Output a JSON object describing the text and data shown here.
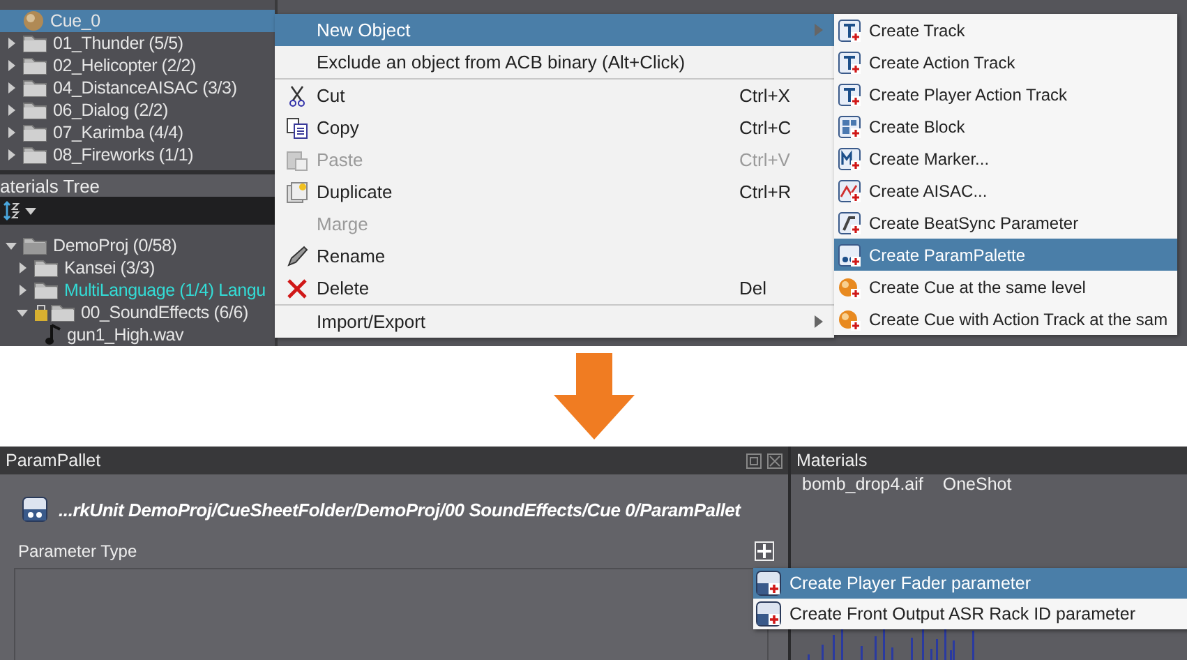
{
  "cue_tree": {
    "items": [
      {
        "label": "Cue_0",
        "kind": "cue",
        "selected": true
      },
      {
        "label": "01_Thunder (5/5)",
        "kind": "folder",
        "expanded": false,
        "selected": false
      },
      {
        "label": "02_Helicopter (2/2)",
        "kind": "folder",
        "expanded": false,
        "selected": false
      },
      {
        "label": "04_DistanceAISAC (3/3)",
        "kind": "folder",
        "expanded": false,
        "selected": false
      },
      {
        "label": "06_Dialog (2/2)",
        "kind": "folder",
        "expanded": false,
        "selected": false
      },
      {
        "label": "07_Karimba (4/4)",
        "kind": "folder",
        "expanded": false,
        "selected": false
      },
      {
        "label": "08_Fireworks (1/1)",
        "kind": "folder",
        "expanded": false,
        "selected": false
      }
    ]
  },
  "materials_tree": {
    "title": "aterials Tree",
    "items": [
      {
        "label": "DemoProj (0/58)",
        "kind": "folder",
        "expanded": true,
        "selected": false,
        "children": [
          {
            "label": "Kansei (3/3)",
            "kind": "folder",
            "expanded": false,
            "selected": false
          },
          {
            "label": "MultiLanguage (1/4) Langu",
            "kind": "folder",
            "expanded": false,
            "selected": false,
            "color": "#33dcd6"
          },
          {
            "label": "00_SoundEffects (6/6)",
            "kind": "locked",
            "expanded": true,
            "selected": false,
            "children": [
              {
                "label": "gun1_High.wav",
                "kind": "wav",
                "selected": false
              }
            ]
          }
        ]
      }
    ]
  },
  "context_menu": {
    "items": [
      {
        "label": "New Object",
        "kind": "plain",
        "selected": true,
        "submenu": true,
        "disabled": false
      },
      {
        "label": "Exclude an object from ACB binary (Alt+Click)",
        "kind": "plain",
        "selected": false,
        "disabled": false
      },
      {
        "label": "Cut",
        "shortcut": "Ctrl+X",
        "kind": "cut",
        "selected": false,
        "disabled": false,
        "separator_before": true
      },
      {
        "label": "Copy",
        "shortcut": "Ctrl+C",
        "kind": "copy",
        "selected": false,
        "disabled": false
      },
      {
        "label": "Paste",
        "shortcut": "Ctrl+V",
        "kind": "paste",
        "selected": false,
        "disabled": true
      },
      {
        "label": "Duplicate",
        "shortcut": "Ctrl+R",
        "kind": "duplicate",
        "selected": false,
        "disabled": false
      },
      {
        "label": "Marge",
        "kind": "plain",
        "selected": false,
        "disabled": true
      },
      {
        "label": "Rename",
        "kind": "rename",
        "selected": false,
        "disabled": false
      },
      {
        "label": "Delete",
        "shortcut": "Del",
        "kind": "delete",
        "selected": false,
        "disabled": false
      },
      {
        "label": "Import/Export",
        "kind": "plain",
        "selected": false,
        "submenu": true,
        "disabled": false,
        "separator_before": true
      }
    ]
  },
  "submenu": {
    "items": [
      {
        "label": "Create Track",
        "kind": "track",
        "selected": false
      },
      {
        "label": "Create Action Track",
        "kind": "track",
        "selected": false
      },
      {
        "label": "Create Player Action Track",
        "kind": "track",
        "selected": false
      },
      {
        "label": "Create Block",
        "kind": "block",
        "selected": false
      },
      {
        "label": "Create Marker...",
        "kind": "marker",
        "selected": false
      },
      {
        "label": "Create AISAC...",
        "kind": "aisac",
        "selected": false
      },
      {
        "label": "Create BeatSync Parameter",
        "kind": "beatsync",
        "selected": false
      },
      {
        "label": "Create ParamPalette",
        "kind": "palette",
        "selected": true
      },
      {
        "label": "Create Cue at the same level",
        "kind": "cue",
        "selected": false
      },
      {
        "label": "Create Cue with Action Track at the sam",
        "kind": "cue",
        "selected": false
      }
    ]
  },
  "param_pallet": {
    "title": "ParamPallet",
    "path": "...rkUnit DemoProj/CueSheetFolder/DemoProj/00 SoundEffects/Cue 0/ParamPallet",
    "section_label": "Parameter Type",
    "popup": [
      {
        "label": "Create Player Fader parameter",
        "selected": true
      },
      {
        "label": "Create Front Output ASR Rack ID parameter",
        "selected": false
      }
    ]
  },
  "materials": {
    "title": "Materials",
    "file": "bomb_drop4.aif",
    "type": "OneShot"
  }
}
